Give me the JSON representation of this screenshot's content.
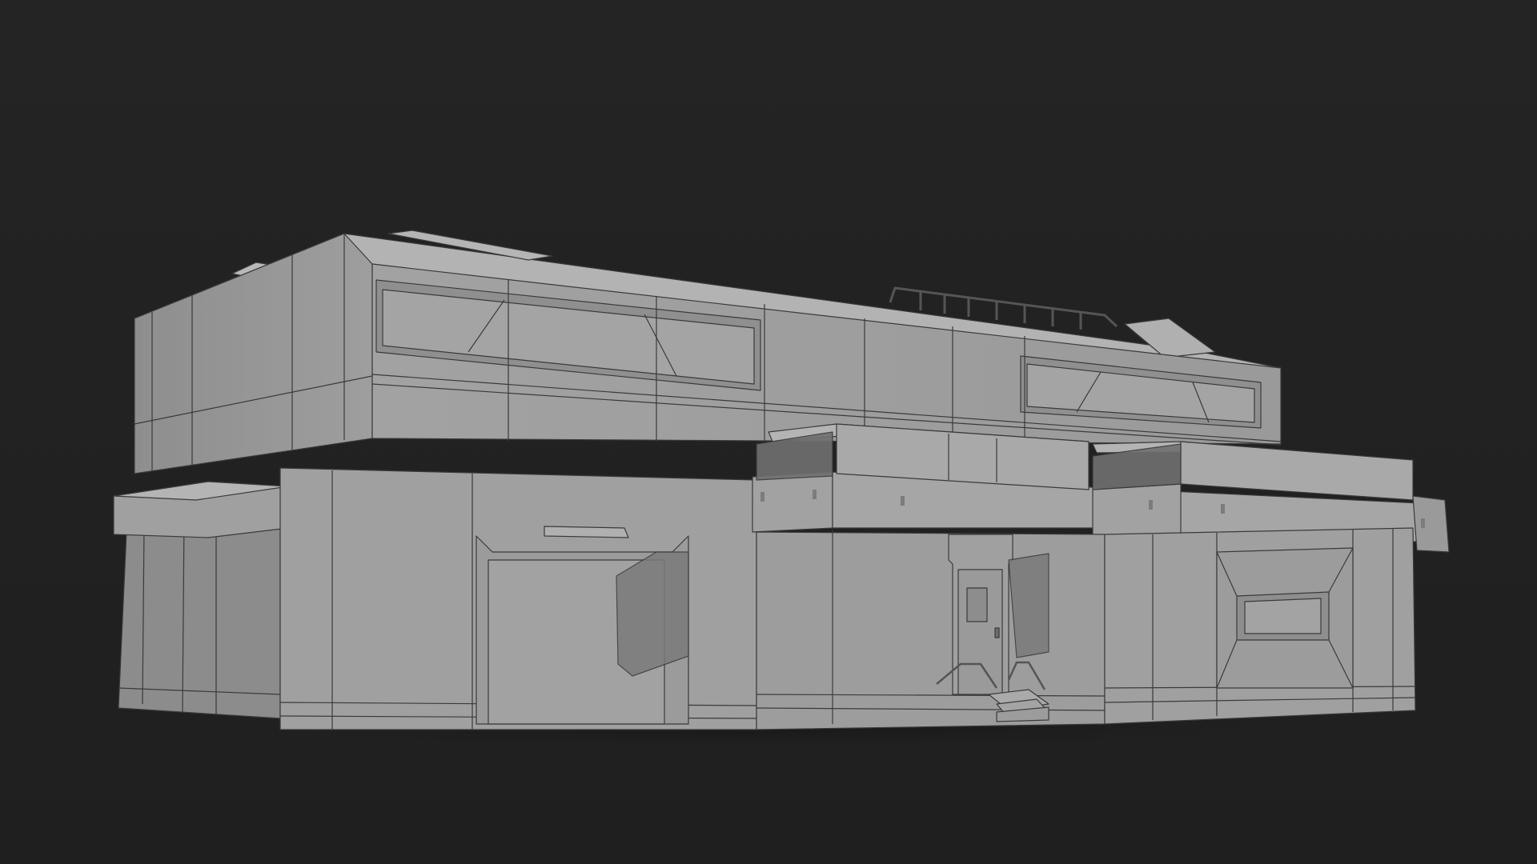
{
  "scene": {
    "subject": "building-model-wireframe-shaded",
    "colors": {
      "background": "#232323",
      "wall_light": "#a3a3a3",
      "wall_mid": "#969696",
      "wall_dark": "#8a8a8a",
      "top_face": "#b2b2b2",
      "shadow": "#6f6f6f",
      "edge_line": "#3a3a3a",
      "ground_shadow": "#1c1c1c"
    }
  }
}
